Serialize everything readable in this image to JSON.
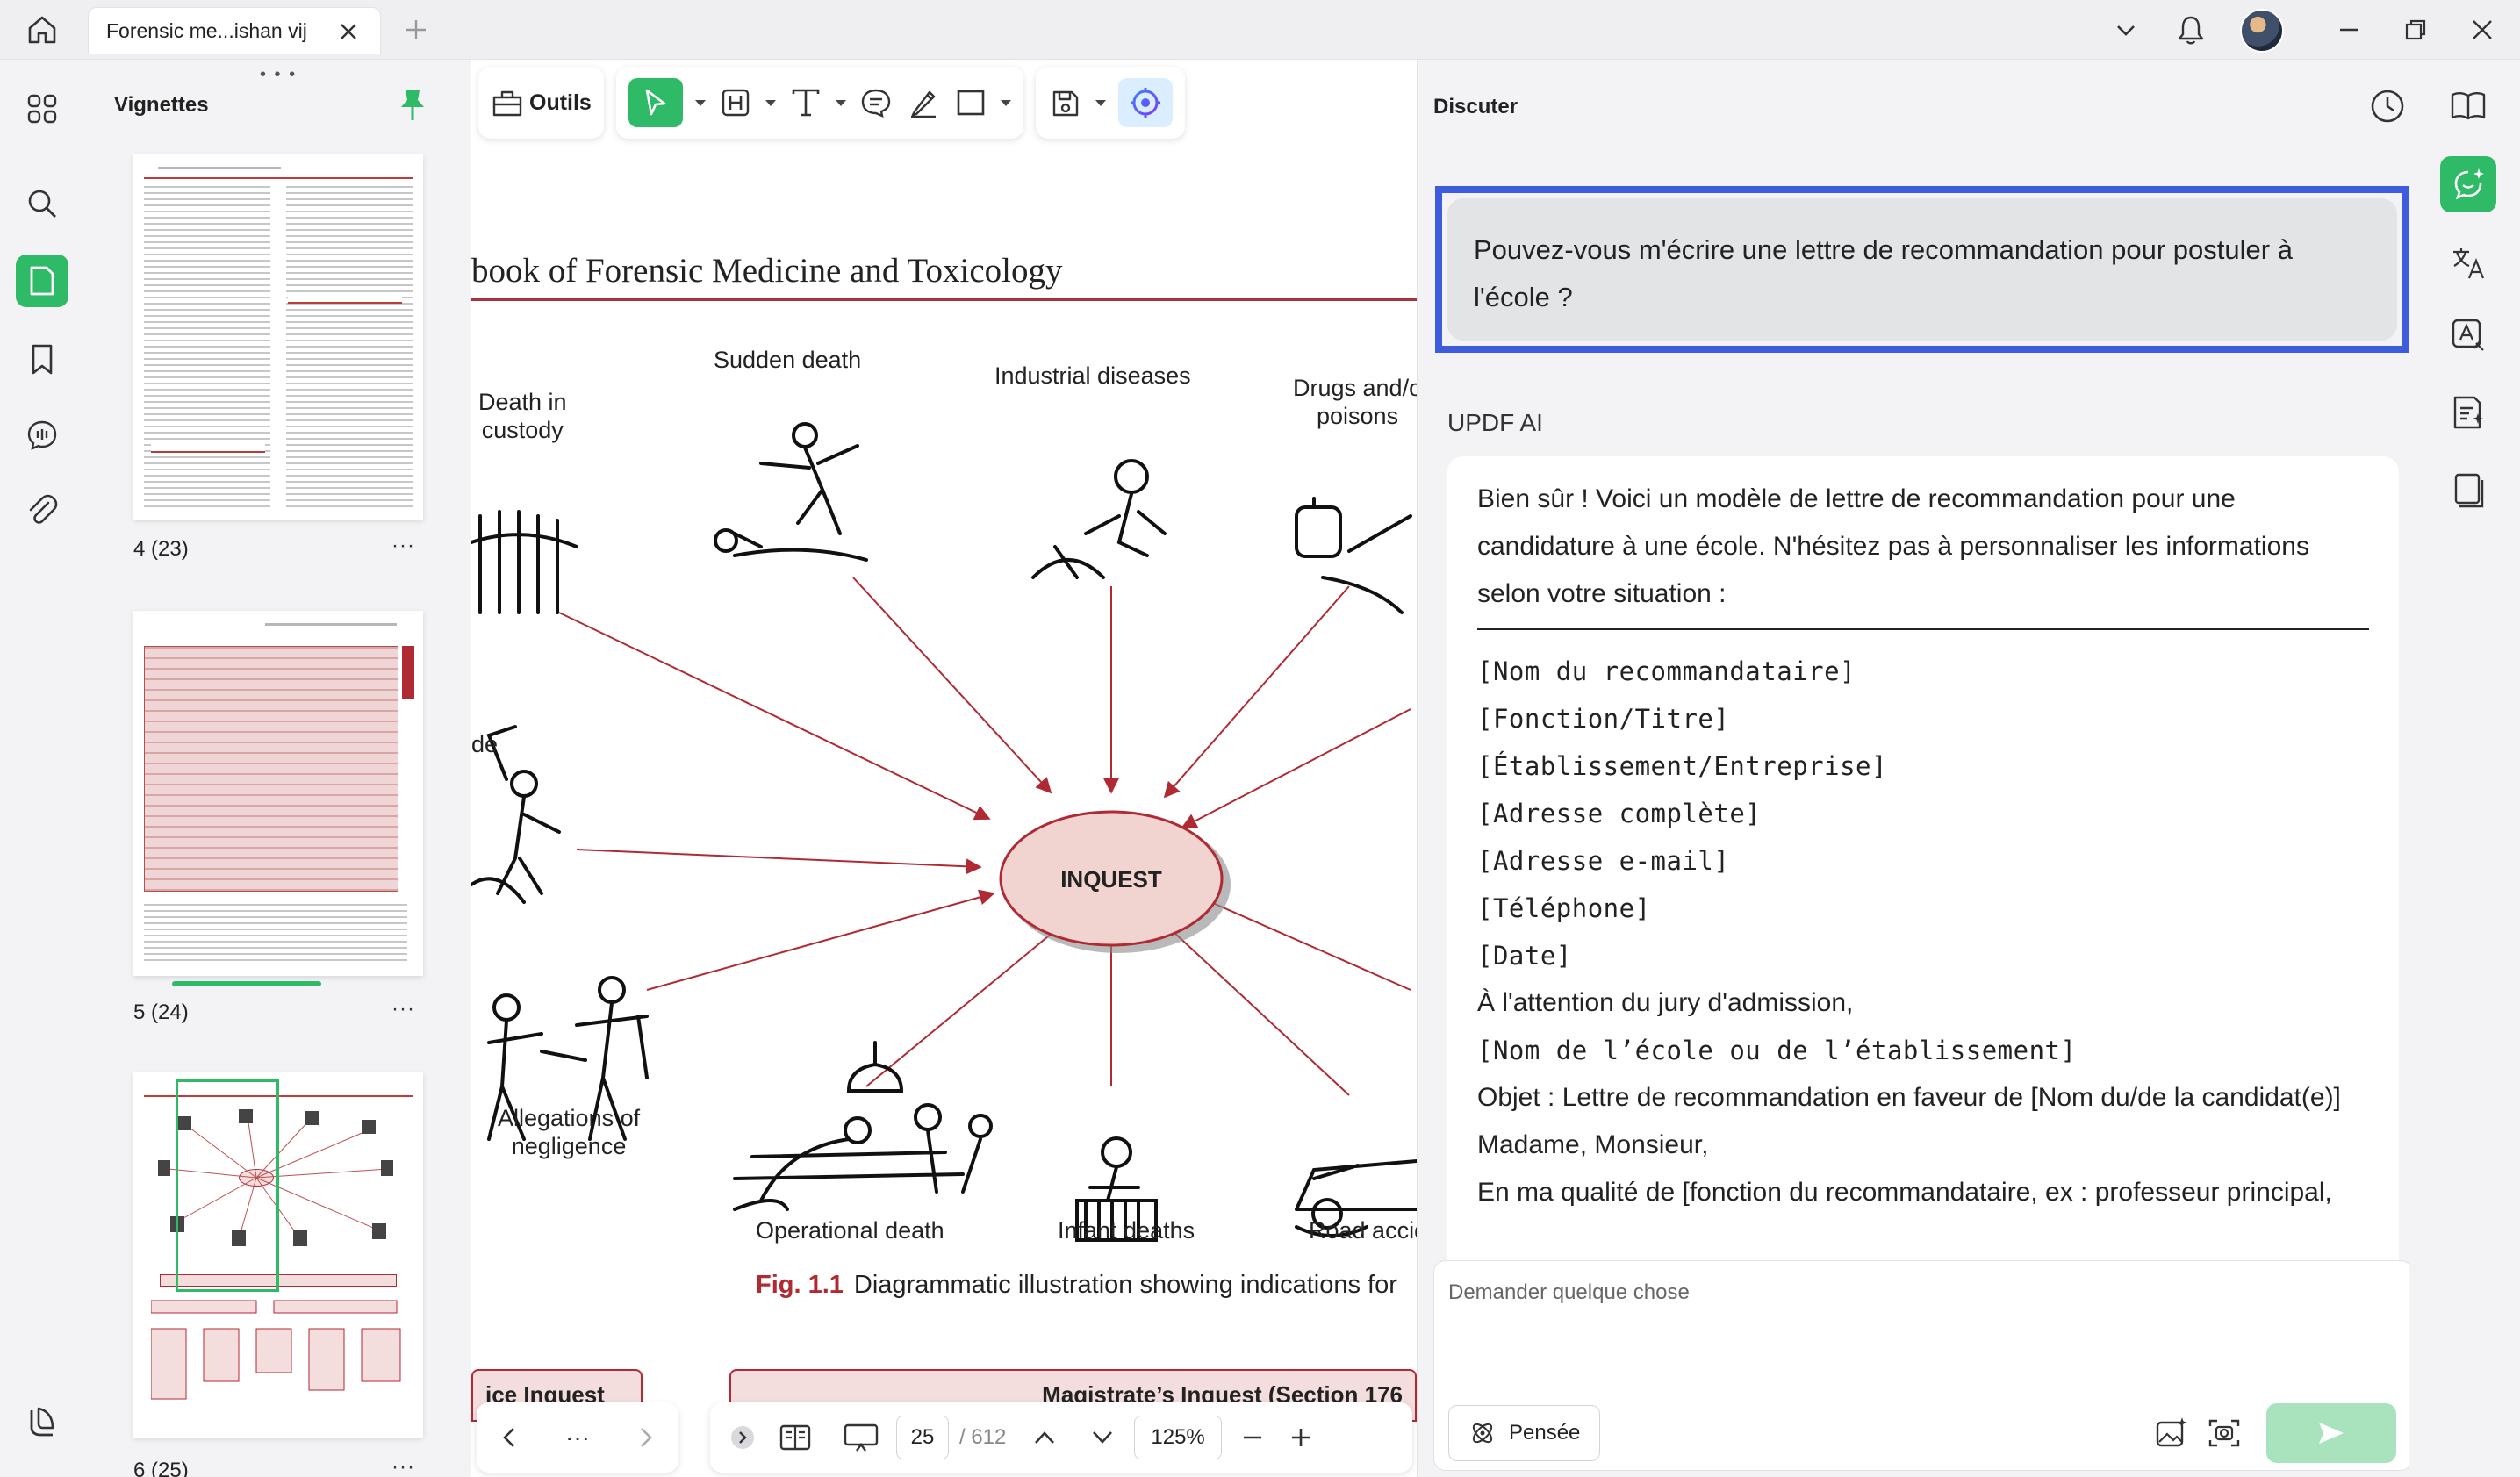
{
  "window": {
    "tab_title": "Forensic me...ishan vij"
  },
  "thumbnails": {
    "header": "Vignettes",
    "pages": [
      {
        "label": "4 (23)"
      },
      {
        "label": "5 (24)"
      },
      {
        "label": "6 (25)"
      }
    ]
  },
  "toolbar": {
    "tools_label": "Outils"
  },
  "document": {
    "running_header": "book of Forensic Medicine and Toxicology",
    "diagram": {
      "center": "INQUEST",
      "labels": {
        "sudden_death": "Sudden death",
        "industrial_diseases": "Industrial diseases",
        "drugs_line1": "Drugs and/o",
        "drugs_line2": "poisons",
        "custody_line1": "Death in",
        "custody_line2": "custody",
        "homicide_fragment": "de",
        "allegations_line1": "Allegations of",
        "allegations_line2": "negligence",
        "operational_death": "Operational death",
        "infant_deaths": "Infant deaths",
        "road_accident": "Road accid"
      }
    },
    "caption_num": "Fig. 1.1",
    "caption_text": "Diagrammatic illustration showing indications for",
    "box_left": "ice Inquest",
    "box_right": "Magistrate’s Inquest (Section 176"
  },
  "page_nav": {
    "current_page": "25",
    "total_pages": "/ 612",
    "zoom": "125%"
  },
  "chat": {
    "title": "Discuter",
    "user_message": "Pouvez-vous m'écrire une lettre de recommandation pour postuler à l'école ?",
    "ai_name": "UPDF AI",
    "ai_intro": "Bien sûr ! Voici un modèle de lettre de recommandation pour une candidature à une école. N'hésitez pas à personnaliser les informations selon votre situation :",
    "ai_fields": [
      "[Nom du recommandataire]",
      "[Fonction/Titre]",
      "[Établissement/Entreprise]",
      "[Adresse complète]",
      "[Adresse e-mail]",
      "[Téléphone]",
      "[Date]"
    ],
    "ai_attention": "À l'attention du jury d'admission,",
    "ai_school": "[Nom de l’école ou de l’établissement]",
    "ai_object": "Objet : Lettre de recommandation en faveur de [Nom du/de la candidat(e)]",
    "ai_salutation": "Madame, Monsieur,",
    "ai_body_start": "En ma qualité de [fonction du recommandataire, ex : professeur principal,",
    "input_placeholder": "Demander quelque chose",
    "think_label": "Pensée"
  },
  "colors": {
    "accent_green": "#2fba67",
    "highlight_blue": "#3d5cdb",
    "figure_red": "#b02a34"
  }
}
